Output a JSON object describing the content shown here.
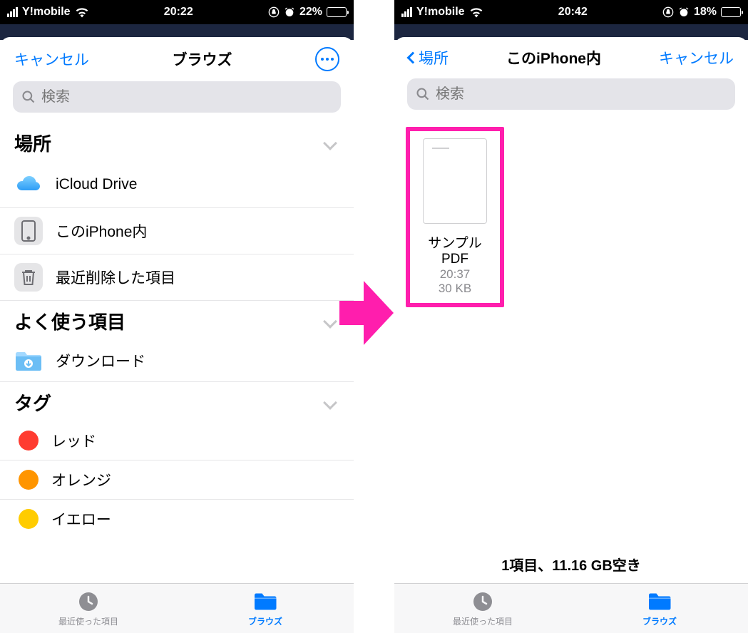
{
  "left": {
    "status": {
      "carrier": "Y!mobile",
      "time": "20:22",
      "battery_pct": "22%",
      "battery_level": 22
    },
    "nav": {
      "cancel": "キャンセル",
      "title": "ブラウズ"
    },
    "search": {
      "placeholder": "検索"
    },
    "sections": {
      "locations_title": "場所",
      "favorites_title": "よく使う項目",
      "tags_title": "タグ"
    },
    "locations": [
      {
        "label": "iCloud Drive"
      },
      {
        "label": "このiPhone内"
      },
      {
        "label": "最近削除した項目"
      }
    ],
    "favorites": [
      {
        "label": "ダウンロード"
      }
    ],
    "tags": [
      {
        "label": "レッド",
        "color": "#ff3b30"
      },
      {
        "label": "オレンジ",
        "color": "#ff9500"
      },
      {
        "label": "イエロー",
        "color": "#ffcc00"
      }
    ],
    "tabs": {
      "recent": "最近使った項目",
      "browse": "ブラウズ"
    }
  },
  "right": {
    "status": {
      "carrier": "Y!mobile",
      "time": "20:42",
      "battery_pct": "18%",
      "battery_level": 18
    },
    "nav": {
      "back": "場所",
      "title": "このiPhone内",
      "cancel": "キャンセル"
    },
    "search": {
      "placeholder": "検索"
    },
    "files": [
      {
        "name": "サンプルPDF",
        "time": "20:37",
        "size": "30 KB"
      }
    ],
    "footer": "1項目、11.16 GB空き",
    "tabs": {
      "recent": "最近使った項目",
      "browse": "ブラウズ"
    }
  }
}
